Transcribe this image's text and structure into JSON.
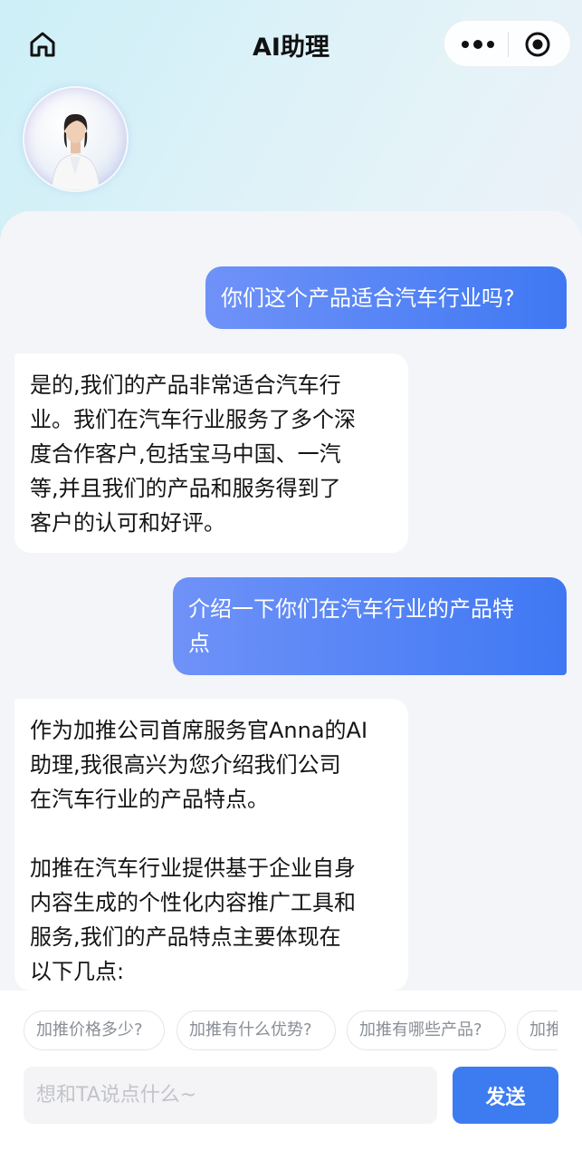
{
  "header": {
    "title": "AI助理",
    "home_icon": "home-icon",
    "more_icon": "more-dots-icon",
    "close_icon": "target-circle-icon"
  },
  "messages": [
    {
      "role": "user",
      "text": "你们这个产品适合汽车行业吗?"
    },
    {
      "role": "assistant",
      "text": "是的,我们的产品非常适合汽车行\n业。我们在汽车行业服务了多个深\n度合作客户,包括宝马中国、一汽\n等,并且我们的产品和服务得到了\n客户的认可和好评。"
    },
    {
      "role": "user",
      "text": "介绍一下你们在汽车行业的产品特\n点"
    },
    {
      "role": "assistant",
      "text": "作为加推公司首席服务官Anna的AI\n助理,我很高兴为您介绍我们公司\n在汽车行业的产品特点。\n\n加推在汽车行业提供基于企业自身\n内容生成的个性化内容推广工具和\n服务,我们的产品特点主要体现在\n以下几点:"
    }
  ],
  "suggestions": [
    "加推价格多少?",
    "加推有什么优势?",
    "加推有哪些产品?",
    "加推"
  ],
  "input": {
    "placeholder": "想和TA说点什么~",
    "value": ""
  },
  "send_label": "发送",
  "colors": {
    "accent": "#3d7bf0",
    "user_bubble": "#4f80f5",
    "panel_bg": "#f4f5f8"
  }
}
